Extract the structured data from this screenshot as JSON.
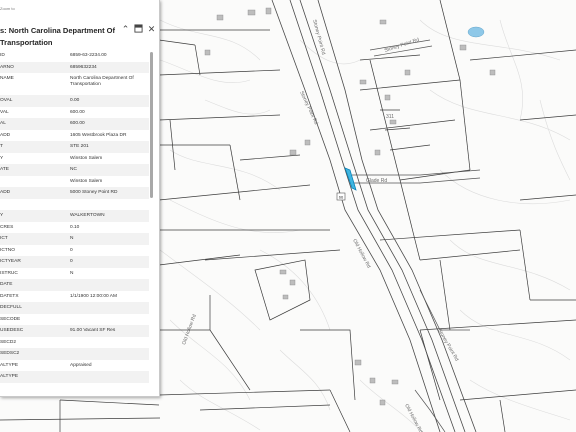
{
  "popup": {
    "zoom_to_label": "Zoom to",
    "title": "s: North Carolina Department Of Transportation",
    "collapse_icon": "chevron-up-icon",
    "dock_icon": "dock-icon",
    "close_icon": "close-icon",
    "fields": [
      {
        "key": "ID",
        "value": "6859-63-2234.00"
      },
      {
        "key": "ARNO",
        "value": "6859632234"
      },
      {
        "key": "NAME",
        "value": "North Carolina Department Of Transportation"
      },
      {
        "key": "OVAL",
        "value": "0.00"
      },
      {
        "key": "VAL",
        "value": "600.00"
      },
      {
        "key": "AL",
        "value": "600.00"
      },
      {
        "key": "ADD",
        "value": "1605 Westbrook Plaza DR"
      },
      {
        "key": "T",
        "value": "STE 201"
      },
      {
        "key": "Y",
        "value": "Winston Salem"
      },
      {
        "key": "ATE",
        "value": "NC"
      },
      {
        "key": "",
        "value": "Winston Salem"
      },
      {
        "key": "ADD",
        "value": "5000 Stoney Point RD"
      },
      {
        "key": "",
        "value": ""
      },
      {
        "key": "Y",
        "value": "WALKERTOWN"
      },
      {
        "key": "CRES",
        "value": "0.10"
      },
      {
        "key": "ICT",
        "value": "N"
      },
      {
        "key": "ICTNO",
        "value": "0"
      },
      {
        "key": "ICTYEAR",
        "value": "0"
      },
      {
        "key": "ISTRUC",
        "value": "N"
      },
      {
        "key": "DATE",
        "value": ""
      },
      {
        "key": "DATETX",
        "value": "1/1/1900 12:00:00 AM"
      },
      {
        "key": "DECFULL",
        "value": ""
      },
      {
        "key": "SECODE",
        "value": ""
      },
      {
        "key": "USEDESC",
        "value": "91.00 Vacant SF Res"
      },
      {
        "key": "SECD2",
        "value": ""
      },
      {
        "key": "SEDSC2",
        "value": ""
      },
      {
        "key": "ALTYPE",
        "value": "Appraised"
      },
      {
        "key": "ALTYPE",
        "value": ""
      }
    ]
  },
  "map": {
    "road_labels": [
      "Stoney Point Rd",
      "Stoney Point Rd",
      "Stoney Point Rd",
      "Glade Rd",
      "Old Hollow Rd",
      "Old Hollow Rd",
      "Stoney Point Rd",
      "Old Hollow Rd",
      "311"
    ],
    "route_shields": [
      "66"
    ]
  }
}
